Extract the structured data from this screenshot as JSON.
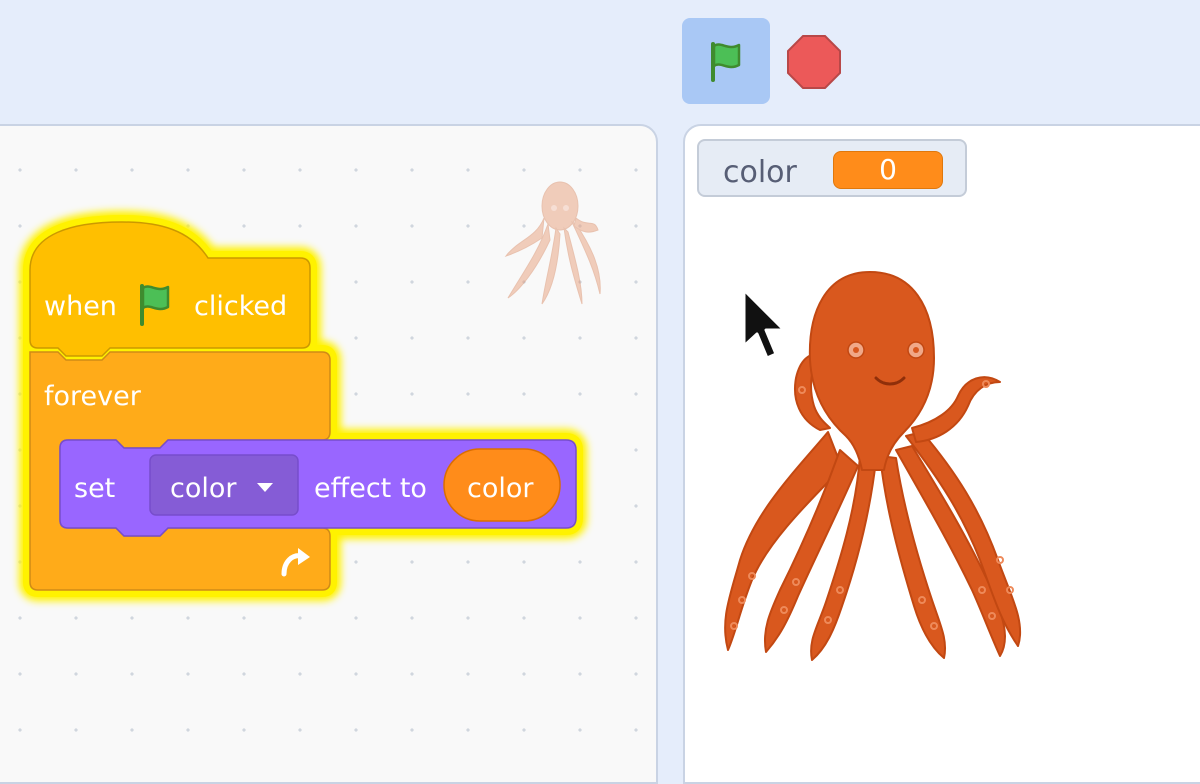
{
  "toolbar": {
    "green_flag_icon": "green-flag-icon",
    "stop_icon": "stop-sign-icon"
  },
  "script": {
    "hat_block": {
      "prefix": "when",
      "icon": "green-flag-icon",
      "suffix": "clicked"
    },
    "loop_block": {
      "label": "forever",
      "loop_icon": "loop-arrow-icon"
    },
    "looks_block": {
      "set_label": "set",
      "effect_option": "color",
      "effect_to_label": "effect to",
      "value_reporter": "color"
    }
  },
  "stage": {
    "variable_monitor": {
      "name": "color",
      "value": "0"
    }
  },
  "colors": {
    "events_block": "#ffbf00",
    "control_block": "#ffab19",
    "looks_block": "#9966ff",
    "variable_reporter": "#ff8c1a",
    "glow": "#fff200",
    "stop_button": "#ec5959"
  }
}
